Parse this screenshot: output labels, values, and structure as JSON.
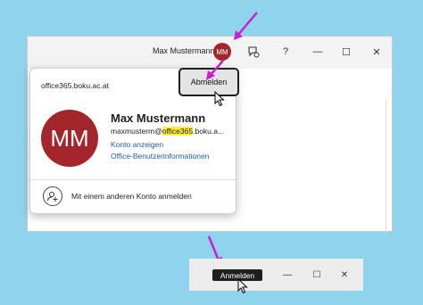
{
  "titlebar": {
    "user_name": "Max Mustermann",
    "avatar_initials": "MM",
    "help_label": "?",
    "minimize_glyph": "—",
    "maximize_glyph": "☐",
    "close_glyph": "✕"
  },
  "account_card": {
    "domain": "office365.boku.ac.at",
    "signout_label": "Abmelden",
    "avatar_initials": "MM",
    "full_name": "Max Mustermann",
    "email_prefix": "maxmusterm@",
    "email_highlight": "office365",
    "email_suffix": ".boku.a...",
    "link_view_account": "Konto anzeigen",
    "link_office_info": "Office-Benutzerinformationen",
    "add_account_label": "Mit einem anderen Konto anmelden"
  },
  "bottom_bar": {
    "signout_label": "Anmelden",
    "minimize_glyph": "—",
    "maximize_glyph": "☐",
    "close_glyph": "✕"
  },
  "colors": {
    "background": "#8fd3ec",
    "avatar": "#a4262c",
    "highlight": "#ffee33",
    "link": "#1a5fb4",
    "annotation_arrow": "#c81fd0"
  }
}
